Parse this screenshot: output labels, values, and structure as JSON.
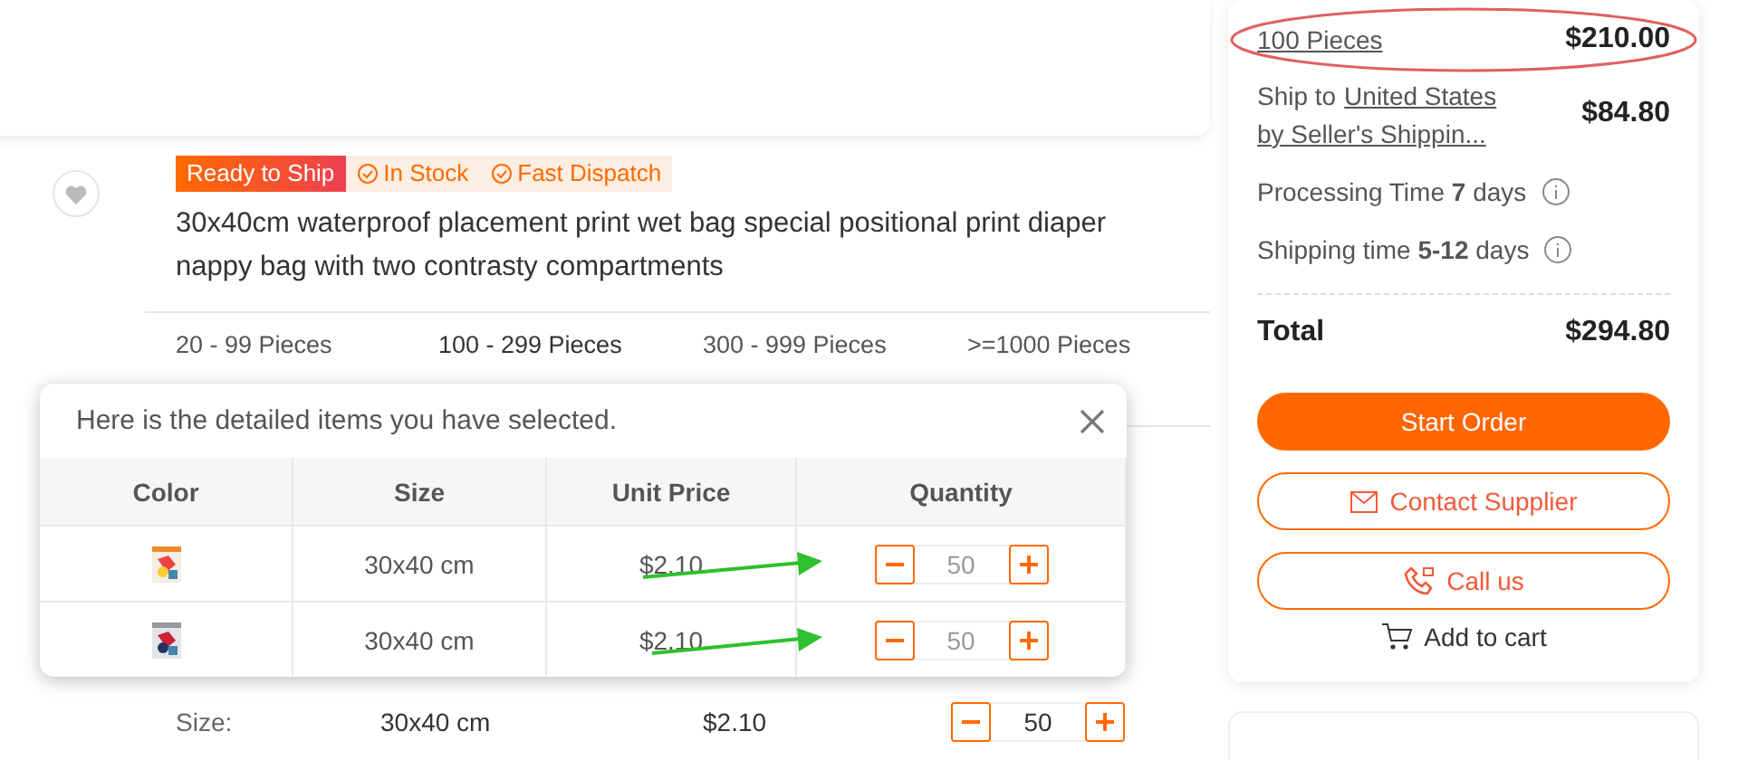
{
  "product": {
    "favorited": false,
    "badges": [
      {
        "kind": "primary",
        "label": "Ready to Ship"
      },
      {
        "kind": "check",
        "label": "In Stock"
      },
      {
        "kind": "check",
        "label": "Fast Dispatch"
      }
    ],
    "title": "30x40cm waterproof placement print wet bag special positional print diaper nappy bag with two contrasty compartments",
    "tiers": [
      {
        "range": "20 - 99 Pieces",
        "selected": false
      },
      {
        "range": "100 - 299 Pieces",
        "selected": true
      },
      {
        "range": "300 - 999 Pieces",
        "selected": false
      },
      {
        "range": ">=1000 Pieces",
        "selected": false
      }
    ],
    "size_row": {
      "label": "Size:",
      "size": "30x40 cm",
      "price": "$2.10",
      "quantity": "50"
    }
  },
  "popup": {
    "message": "Here is the detailed items you have selected.",
    "columns": [
      "Color",
      "Size",
      "Unit Price",
      "Quantity"
    ],
    "rows": [
      {
        "size": "30x40 cm",
        "unit_price": "$2.10",
        "quantity": "50"
      },
      {
        "size": "30x40 cm",
        "unit_price": "$2.10",
        "quantity": "50"
      }
    ]
  },
  "summary": {
    "quantity": "100 Pieces",
    "subtotal": "$210.00",
    "ship_prefix": "Ship to",
    "ship_country": "United States",
    "ship_method": "by Seller's Shippin...",
    "shipping_cost": "$84.80",
    "processing": {
      "label": "Processing Time",
      "value": "7",
      "unit": "days"
    },
    "shipping_time": {
      "label": "Shipping time",
      "value": "5-12",
      "unit": "days"
    },
    "total_label": "Total",
    "total": "$294.80",
    "actions": [
      {
        "kind": "primary",
        "label": "Start Order"
      },
      {
        "kind": "mail",
        "label": "Contact Supplier"
      },
      {
        "kind": "phone",
        "label": "Call us"
      },
      {
        "kind": "cart",
        "label": "Add to cart"
      }
    ]
  }
}
